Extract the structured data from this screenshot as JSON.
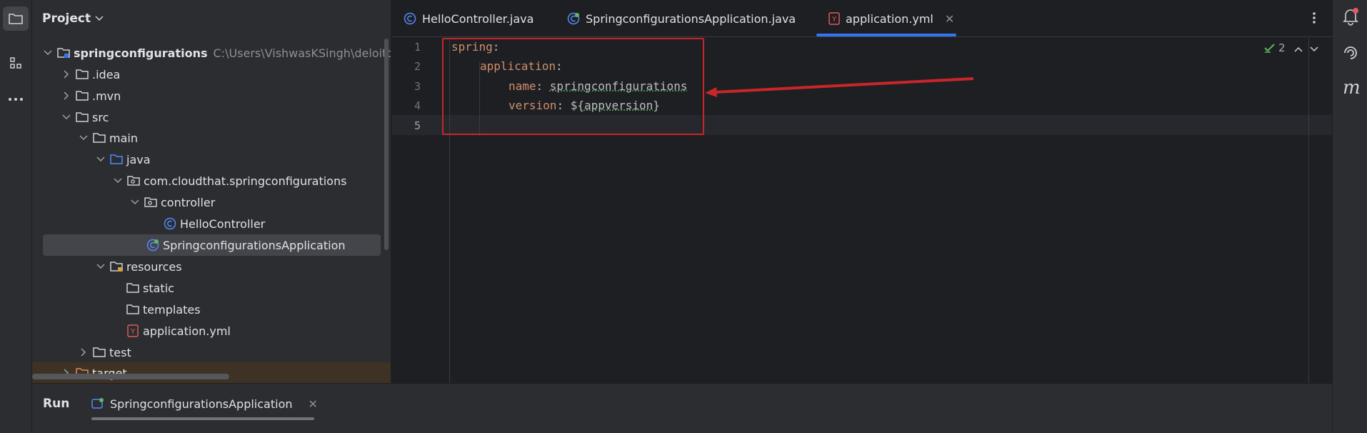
{
  "project_panel": {
    "title": "Project",
    "tree": [
      {
        "label": "springconfigurations",
        "path": "C:\\Users\\VishwasKSingh\\deloitt",
        "icon": "module-folder-icon"
      },
      {
        "label": ".idea",
        "icon": "folder-icon"
      },
      {
        "label": ".mvn",
        "icon": "folder-icon"
      },
      {
        "label": "src",
        "icon": "folder-icon"
      },
      {
        "label": "main",
        "icon": "folder-icon"
      },
      {
        "label": "java",
        "icon": "source-folder-icon"
      },
      {
        "label": "com.cloudthat.springconfigurations",
        "icon": "package-icon"
      },
      {
        "label": "controller",
        "icon": "package-icon"
      },
      {
        "label": "HelloController",
        "icon": "class-icon"
      },
      {
        "label": "SpringconfigurationsApplication",
        "icon": "spring-class-icon"
      },
      {
        "label": "resources",
        "icon": "resources-folder-icon"
      },
      {
        "label": "static",
        "icon": "folder-icon"
      },
      {
        "label": "templates",
        "icon": "folder-icon"
      },
      {
        "label": "application.yml",
        "icon": "yaml-file-icon"
      },
      {
        "label": "test",
        "icon": "folder-icon"
      },
      {
        "label": "target",
        "icon": "excluded-folder-icon"
      }
    ]
  },
  "editor_tabs": [
    {
      "label": "HelloController.java",
      "icon": "class-icon"
    },
    {
      "label": "SpringconfigurationsApplication.java",
      "icon": "spring-class-icon"
    },
    {
      "label": "application.yml",
      "icon": "yaml-file-icon",
      "active": true
    }
  ],
  "editor": {
    "line_numbers": [
      "1",
      "2",
      "3",
      "4",
      "5"
    ],
    "lines": [
      {
        "key": "spring",
        "sep": ":"
      },
      {
        "key": "application",
        "sep": ":"
      },
      {
        "key": "name",
        "sep": ": ",
        "value": "springconfigurations"
      },
      {
        "key": "version",
        "sep": ": ",
        "prefix": "${",
        "value": "appversion",
        "suffix": "}"
      },
      {}
    ],
    "inspection_count": "2"
  },
  "bottom_panel": {
    "title": "Run",
    "run_tab": "SpringconfigurationsApplication"
  },
  "colors": {
    "accent": "#3574f0",
    "annotation_red": "#c8262b",
    "yaml_key": "#cf8e6d"
  }
}
